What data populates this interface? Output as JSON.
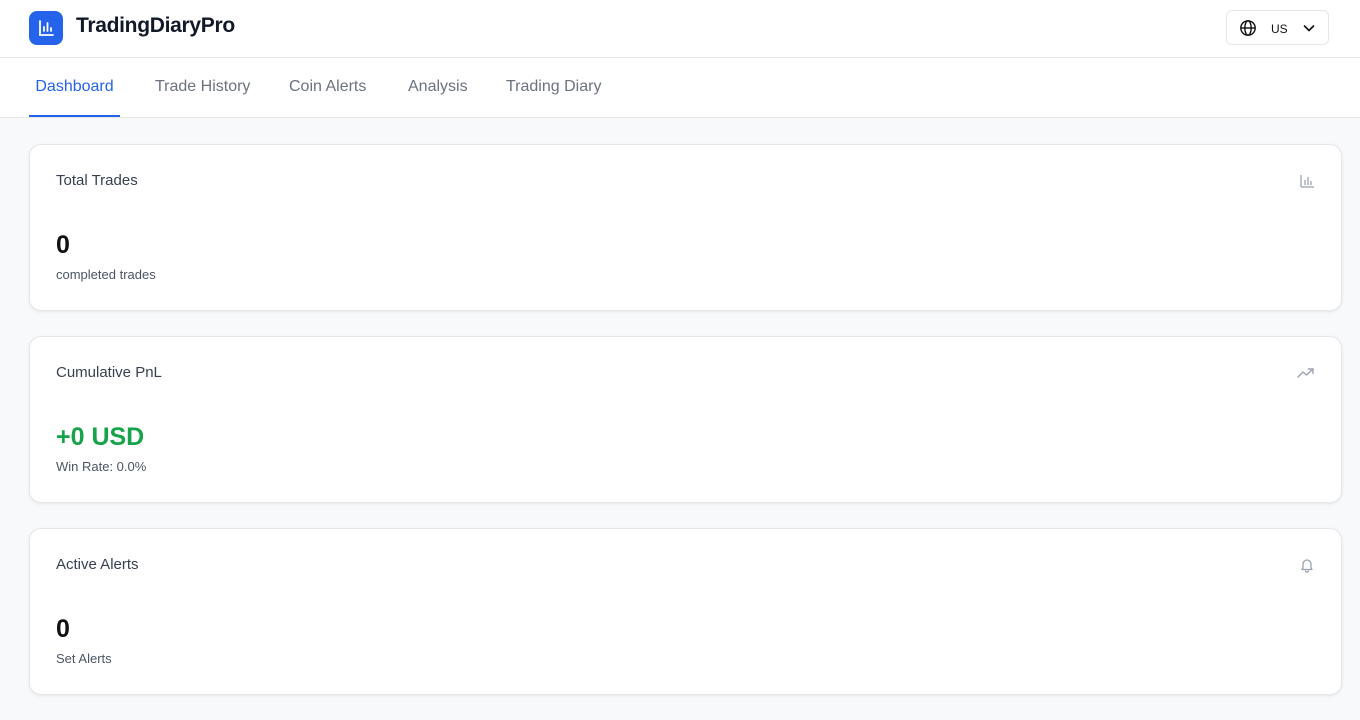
{
  "app": {
    "title": "TradingDiaryPro",
    "logo_icon": "bar-chart-icon",
    "accent_color": "#2563eb"
  },
  "language": {
    "selected": "US",
    "icon": "globe-icon"
  },
  "tabs": [
    {
      "label": "Dashboard",
      "active": true
    },
    {
      "label": "Trade History",
      "active": false
    },
    {
      "label": "Coin Alerts",
      "active": false
    },
    {
      "label": "Analysis",
      "active": false
    },
    {
      "label": "Trading Diary",
      "active": false
    }
  ],
  "cards": {
    "total_trades": {
      "title": "Total Trades",
      "value": "0",
      "subtitle": "completed trades",
      "icon": "bar-chart-icon"
    },
    "cumulative_pnl": {
      "title": "Cumulative PnL",
      "value": "+0 USD",
      "subtitle": "Win Rate: 0.0%",
      "icon": "trending-up-icon",
      "value_color": "#16a34a"
    },
    "active_alerts": {
      "title": "Active Alerts",
      "value": "0",
      "subtitle": "Set Alerts",
      "icon": "bell-icon"
    }
  }
}
